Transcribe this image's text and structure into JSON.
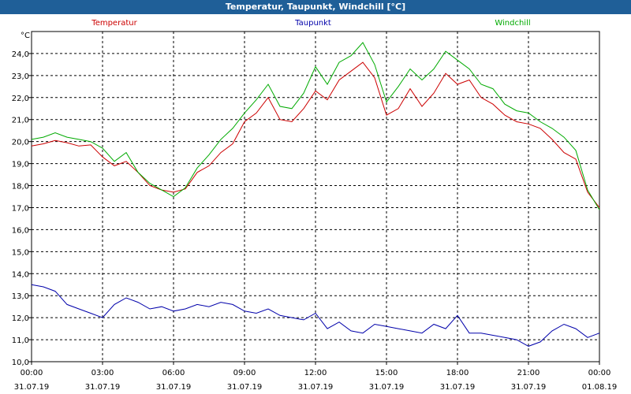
{
  "window": {
    "title": "Temperatur, Taupunkt, Windchill [°C]"
  },
  "chart_data": {
    "type": "line",
    "title": "Temperatur, Taupunkt, Windchill [°C]",
    "y_unit": "°C",
    "ylim": [
      10.0,
      25.0
    ],
    "y_ticks": [
      "10,0",
      "11,0",
      "12,0",
      "13,0",
      "14,0",
      "15,0",
      "16,0",
      "17,0",
      "18,0",
      "19,0",
      "20,0",
      "21,0",
      "22,0",
      "23,0",
      "24,0"
    ],
    "xlim_hours": [
      0,
      24
    ],
    "x_ticks": [
      {
        "time": "00:00",
        "date": "31.07.19"
      },
      {
        "time": "03:00",
        "date": "31.07.19"
      },
      {
        "time": "06:00",
        "date": "31.07.19"
      },
      {
        "time": "09:00",
        "date": "31.07.19"
      },
      {
        "time": "12:00",
        "date": "31.07.19"
      },
      {
        "time": "15:00",
        "date": "31.07.19"
      },
      {
        "time": "18:00",
        "date": "31.07.19"
      },
      {
        "time": "21:00",
        "date": "31.07.19"
      },
      {
        "time": "00:00",
        "date": "01.08.19"
      }
    ],
    "grid": true,
    "series": [
      {
        "name": "Temperatur",
        "color": "#cc0000",
        "x": [
          0,
          0.5,
          1,
          1.5,
          2,
          2.5,
          3,
          3.5,
          4,
          4.5,
          5,
          5.5,
          6,
          6.5,
          7,
          7.5,
          8,
          8.5,
          9,
          9.5,
          10,
          10.5,
          11,
          11.5,
          12,
          12.5,
          13,
          13.5,
          14,
          14.5,
          15,
          15.5,
          16,
          16.5,
          17,
          17.5,
          18,
          18.5,
          19,
          19.5,
          20,
          20.5,
          21,
          21.5,
          22,
          22.5,
          23,
          23.5,
          24
        ],
        "values": [
          19.8,
          19.9,
          20.05,
          19.95,
          19.8,
          19.85,
          19.3,
          18.9,
          19.1,
          18.6,
          18.0,
          17.8,
          17.7,
          17.85,
          18.6,
          18.9,
          19.5,
          19.9,
          20.9,
          21.3,
          22.0,
          21.0,
          20.9,
          21.5,
          22.3,
          21.9,
          22.8,
          23.2,
          23.6,
          22.9,
          21.2,
          21.5,
          22.4,
          21.6,
          22.2,
          23.1,
          22.6,
          22.8,
          22.0,
          21.7,
          21.2,
          20.9,
          20.8,
          20.6,
          20.1,
          19.5,
          19.2,
          17.7,
          17.0
        ]
      },
      {
        "name": "Taupunkt",
        "color": "#0000aa",
        "x": [
          0,
          0.5,
          1,
          1.5,
          2,
          2.5,
          3,
          3.5,
          4,
          4.5,
          5,
          5.5,
          6,
          6.5,
          7,
          7.5,
          8,
          8.5,
          9,
          9.5,
          10,
          10.5,
          11,
          11.5,
          12,
          12.5,
          13,
          13.5,
          14,
          14.5,
          15,
          15.5,
          16,
          16.5,
          17,
          17.5,
          18,
          18.5,
          19,
          19.5,
          20,
          20.5,
          21,
          21.5,
          22,
          22.5,
          23,
          23.5,
          24
        ],
        "values": [
          13.5,
          13.4,
          13.2,
          12.6,
          12.4,
          12.2,
          12.0,
          12.6,
          12.9,
          12.7,
          12.4,
          12.5,
          12.3,
          12.4,
          12.6,
          12.5,
          12.7,
          12.6,
          12.3,
          12.2,
          12.4,
          12.1,
          12.0,
          11.9,
          12.2,
          11.5,
          11.8,
          11.4,
          11.3,
          11.7,
          11.6,
          11.5,
          11.4,
          11.3,
          11.7,
          11.5,
          12.1,
          11.3,
          11.3,
          11.2,
          11.1,
          11.0,
          10.7,
          10.9,
          11.4,
          11.7,
          11.5,
          11.1,
          11.3
        ]
      },
      {
        "name": "Windchill",
        "color": "#00aa00",
        "x": [
          0,
          0.5,
          1,
          1.5,
          2,
          2.5,
          3,
          3.5,
          4,
          4.5,
          5,
          5.5,
          6,
          6.5,
          7,
          7.5,
          8,
          8.5,
          9,
          9.5,
          10,
          10.5,
          11,
          11.5,
          12,
          12.5,
          13,
          13.5,
          14,
          14.5,
          15,
          15.5,
          16,
          16.5,
          17,
          17.5,
          18,
          18.5,
          19,
          19.5,
          20,
          20.5,
          21,
          21.5,
          22,
          22.5,
          23,
          23.5,
          24
        ],
        "values": [
          20.1,
          20.2,
          20.4,
          20.2,
          20.1,
          20.0,
          19.7,
          19.1,
          19.5,
          18.6,
          18.1,
          17.8,
          17.5,
          17.9,
          18.8,
          19.4,
          20.1,
          20.6,
          21.3,
          21.9,
          22.6,
          21.6,
          21.5,
          22.2,
          23.4,
          22.6,
          23.6,
          23.9,
          24.5,
          23.5,
          21.8,
          22.5,
          23.3,
          22.8,
          23.3,
          24.1,
          23.7,
          23.3,
          22.6,
          22.4,
          21.7,
          21.4,
          21.3,
          20.9,
          20.6,
          20.2,
          19.6,
          17.8,
          16.9
        ]
      }
    ]
  }
}
